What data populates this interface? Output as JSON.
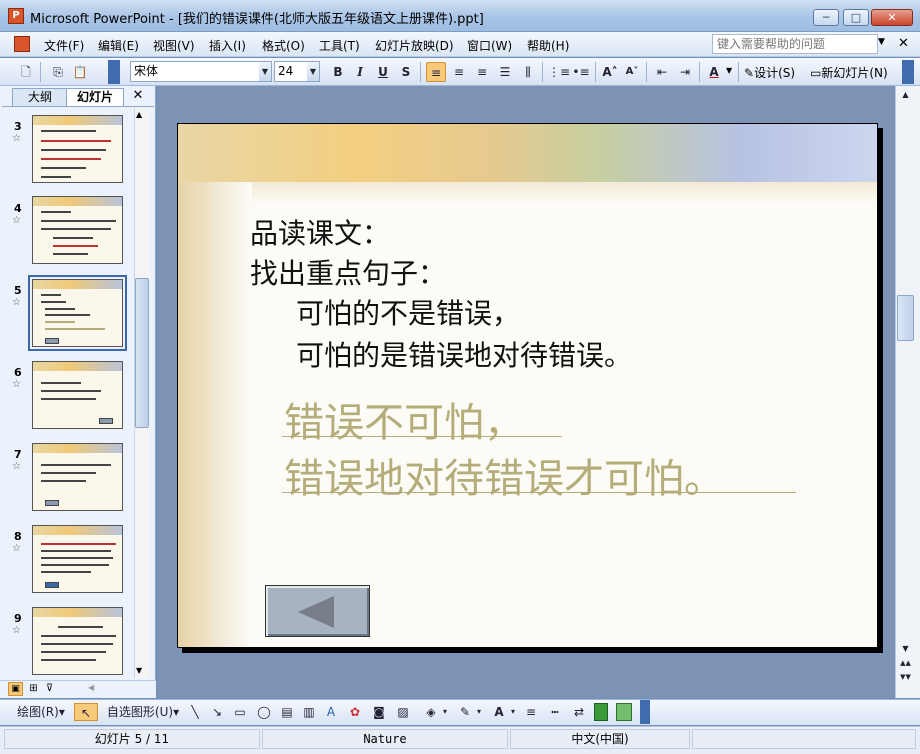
{
  "window": {
    "app_icon_letter": "P",
    "title": "Microsoft PowerPoint - [我们的错误课件(北师大版五年级语文上册课件).ppt]",
    "min_glyph": "─",
    "max_glyph": "□",
    "close_glyph": "✕"
  },
  "menu": {
    "items": [
      "文件(F)",
      "编辑(E)",
      "视图(V)",
      "插入(I)",
      "格式(O)",
      "工具(T)",
      "幻灯片放映(D)",
      "窗口(W)",
      "帮助(H)"
    ],
    "help_placeholder": "键入需要帮助的问题",
    "help_arrow": "▼",
    "doc_close": "✕"
  },
  "toolbar": {
    "font_name": "宋体",
    "font_size": "24",
    "bold": "B",
    "italic": "I",
    "underline": "U",
    "shadow": "S",
    "increase_font": "A˄",
    "decrease_font": "A˅",
    "font_color": "A",
    "design_label": "设计(S)",
    "new_slide_label": "新幻灯片(N)"
  },
  "left_pane": {
    "tab_outline": "大纲",
    "tab_slides": "幻灯片",
    "close": "✕",
    "thumbnails": [
      {
        "num": "3"
      },
      {
        "num": "4"
      },
      {
        "num": "5"
      },
      {
        "num": "6"
      },
      {
        "num": "7"
      },
      {
        "num": "8"
      },
      {
        "num": "9"
      }
    ],
    "star": "☆"
  },
  "slide": {
    "line1": "品读课文：",
    "line2": "找出重点句子：",
    "line3": "可怕的不是错误，",
    "line4": "可怕的是错误地对待错误。",
    "line5": "错误不可怕，",
    "line6": "错误地对待错误才可怕。"
  },
  "drawbar": {
    "draw_label": "绘图(R)",
    "autoshape_label": "自选图形(U)",
    "dropdown_glyph": "▾"
  },
  "status": {
    "slide_pos": "幻灯片 5 / 11",
    "design": "Nature",
    "language": "中文(中国)"
  }
}
